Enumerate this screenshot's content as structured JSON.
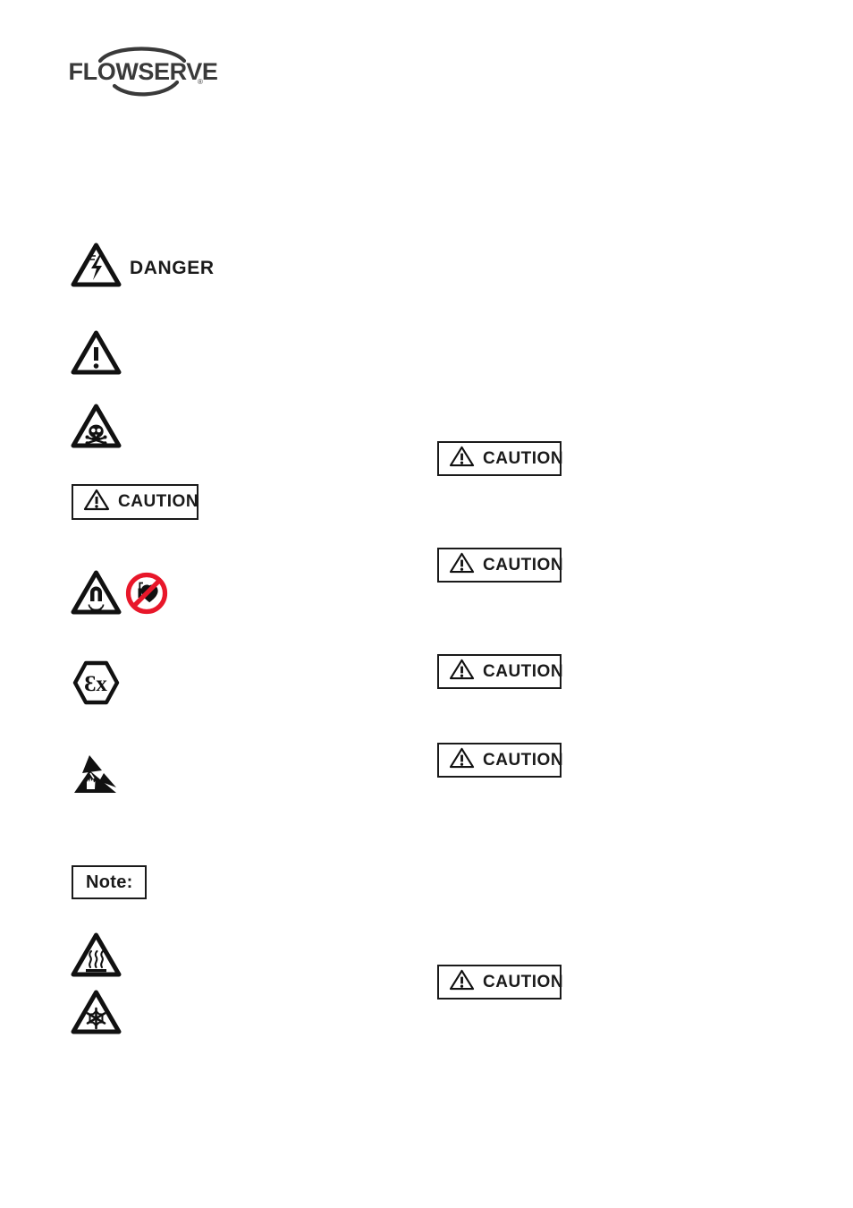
{
  "document": {
    "brand": {
      "name": "FLOWSERVE",
      "registered_mark": "®",
      "color": "#3a3a3a"
    },
    "colors": {
      "ink": "#1a1a1a",
      "prohibition_red": "#e8172a",
      "page_background": "#ffffff"
    }
  },
  "left_column": {
    "items": [
      {
        "key": "danger",
        "icon": "electric-shock-triangle-icon",
        "label": "DANGER"
      },
      {
        "key": "warning",
        "icon": "warning-triangle-icon",
        "label": ""
      },
      {
        "key": "toxic",
        "icon": "toxic-skull-triangle-icon",
        "label": ""
      },
      {
        "key": "caution_box",
        "icon": "warning-triangle-icon",
        "label": "CAUTION"
      },
      {
        "key": "magnetic_pacemaker",
        "icon": "magnetic-field-triangle-icon",
        "icon2": "no-pacemaker-prohibition-icon",
        "label": ""
      },
      {
        "key": "atex",
        "icon": "atex-ex-hexagon-icon",
        "label": ""
      },
      {
        "key": "esd",
        "icon": "electrostatic-discharge-icon",
        "label": ""
      },
      {
        "key": "note_box",
        "icon": "",
        "label": "Note:"
      },
      {
        "key": "hot_surface",
        "icon": "hot-surface-triangle-icon",
        "label": ""
      },
      {
        "key": "cold_surface",
        "icon": "freezing-snowflake-triangle-icon",
        "label": ""
      }
    ]
  },
  "right_column": {
    "notices": [
      {
        "key": "caution_1",
        "icon": "warning-triangle-icon",
        "label": "CAUTION"
      },
      {
        "key": "caution_2",
        "icon": "warning-triangle-icon",
        "label": "CAUTION"
      },
      {
        "key": "caution_3",
        "icon": "warning-triangle-icon",
        "label": "CAUTION"
      },
      {
        "key": "caution_4",
        "icon": "warning-triangle-icon",
        "label": "CAUTION"
      },
      {
        "key": "caution_5",
        "icon": "warning-triangle-icon",
        "label": "CAUTION"
      }
    ]
  }
}
